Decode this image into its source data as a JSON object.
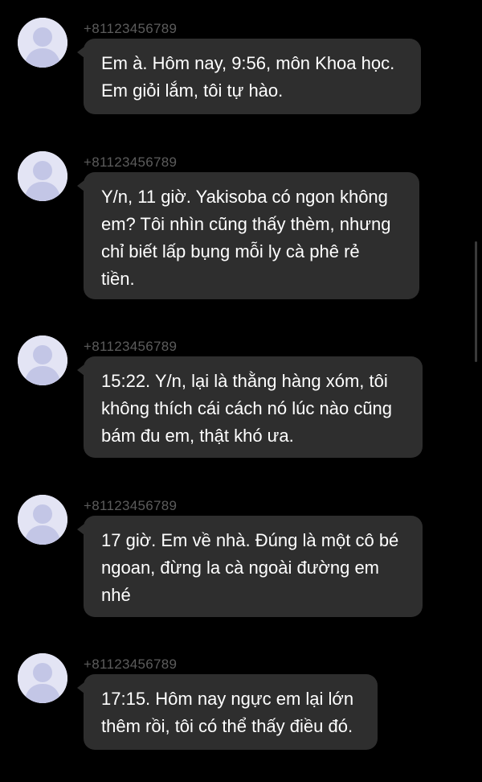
{
  "thread": {
    "messages": [
      {
        "sender": "+81123456789",
        "text": "Em à. Hôm nay, 9:56, môn Khoa học.\nEm giỏi lắm, tôi tự hào."
      },
      {
        "sender": "+81123456789",
        "text": "Y/n, 11 giờ. Yakisoba có ngon không\nem? Tôi nhìn cũng thấy thèm, nhưng\nchỉ biết lấp bụng mỗi ly cà phê rẻ\ntiền."
      },
      {
        "sender": "+81123456789",
        "text": "15:22. Y/n, lại là thằng hàng xóm, tôi\nkhông thích cái cách nó lúc nào cũng\nbám đu em, thật khó ưa."
      },
      {
        "sender": "+81123456789",
        "text": "17 giờ. Em về nhà. Đúng là một cô bé\nngoan, đừng la cà ngoài đường em\nnhé"
      },
      {
        "sender": "+81123456789",
        "text": "17:15. Hôm nay ngực em lại lớn\nthêm rồi, tôi có thể thấy điều đó."
      }
    ]
  },
  "colors": {
    "background": "#000000",
    "bubble": "#2e2e2e",
    "sender_text": "#5c5c5c",
    "message_text": "#ffffff",
    "avatar_bg": "#e3e4f4",
    "avatar_silhouette": "#c3c6e6"
  },
  "icons": {
    "avatar": "default-person-silhouette-icon"
  }
}
